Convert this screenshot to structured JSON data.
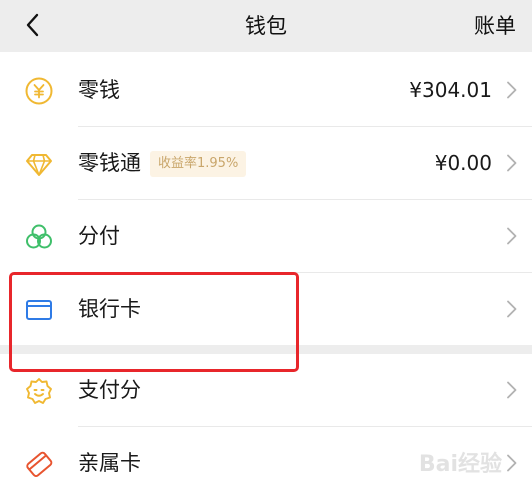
{
  "header": {
    "back_icon": "chevron-left-icon",
    "title": "钱包",
    "right_action": "账单"
  },
  "items": [
    {
      "label": "零钱",
      "value": "¥304.01",
      "icon": "coin-icon"
    },
    {
      "label": "零钱通",
      "badge": "收益率1.95%",
      "value": "¥0.00",
      "icon": "diamond-icon"
    },
    {
      "label": "分付",
      "icon": "fenfu-icon"
    },
    {
      "label": "银行卡",
      "icon": "bank-card-icon"
    },
    {
      "label": "支付分",
      "icon": "payscore-icon"
    },
    {
      "label": "亲属卡",
      "icon": "family-card-icon"
    }
  ],
  "colors": {
    "highlight": "#e8262b",
    "coin": "#f0b832",
    "green": "#3fbf6a",
    "blue": "#2f7be6",
    "badge_text": "#c9a66b"
  },
  "watermark": "Bai经验"
}
